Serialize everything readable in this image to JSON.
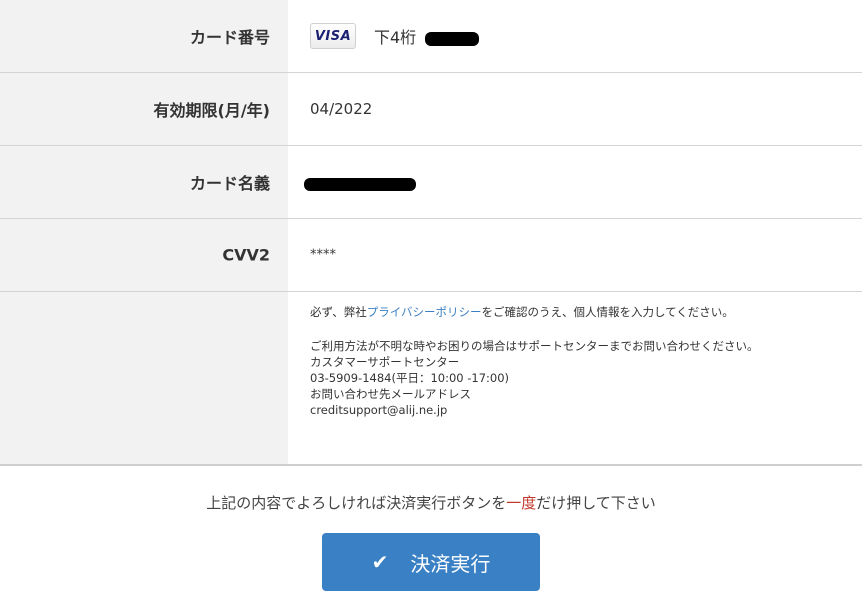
{
  "card_table": {
    "card_number": {
      "label": "カード番号",
      "brand": "VISA",
      "last4_prefix": "下4桁"
    },
    "expiry": {
      "label": "有効期限(月/年)",
      "value": "04/2022"
    },
    "card_holder": {
      "label": "カード名義"
    },
    "cvv": {
      "label": "CVV2",
      "value": "****"
    }
  },
  "info": {
    "line1_before": "必ず、弊社",
    "privacy_link": "プライバシーポリシー",
    "line1_after": "をご確認のうえ、個人情報を入力してください。",
    "line2": "ご利用方法が不明な時やお困りの場合はサポートセンターまでお問い合わせください。",
    "line3": "カスタマーサポートセンター",
    "line4": "03-5909-1484(平日：10:00 -17:00)",
    "line5": "お問い合わせ先メールアドレス",
    "line6": "creditsupport@alij.ne.jp"
  },
  "confirm": {
    "before": "上記の内容でよろしければ決済実行ボタンを",
    "emphasis": "一度",
    "after": "だけ押して下さい"
  },
  "submit_button": {
    "label": "決済実行",
    "icon": "check-icon"
  },
  "colors": {
    "label_bg": "#f2f2f2",
    "button": "#3a80c4",
    "link": "#3a7fc1",
    "emphasis": "#c0392b"
  }
}
